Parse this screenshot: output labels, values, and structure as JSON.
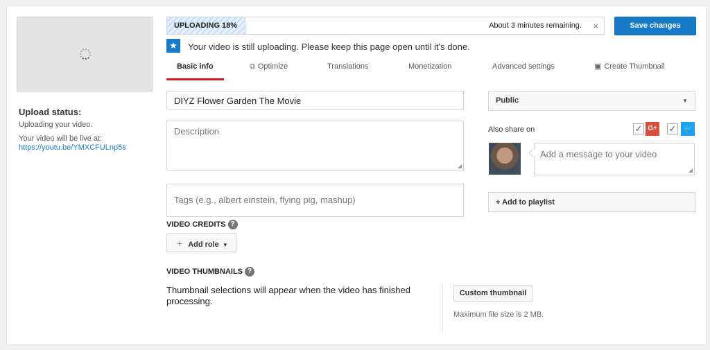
{
  "left": {
    "upload_status_title": "Upload status:",
    "upload_status_text": "Uploading your video.",
    "live_text": "Your video will be live at:",
    "live_link": "https://youtu.be/YMXCFULnp5s"
  },
  "upload": {
    "label": "UPLOADING 18%",
    "progress_percent": 18,
    "remaining": "About 3 minutes remaining.",
    "close_glyph": "×",
    "save_label": "Save changes",
    "notice": "Your video is still uploading. Please keep this page open until it's done."
  },
  "tabs": [
    {
      "label": "Basic info",
      "active": true
    },
    {
      "label": "Optimize",
      "icon": "optimize-icon"
    },
    {
      "label": "Translations"
    },
    {
      "label": "Monetization"
    },
    {
      "label": "Advanced settings"
    },
    {
      "label": "Create Thumbnail",
      "icon": "thumbnail-icon"
    }
  ],
  "form": {
    "title_value": "DIYZ Flower Garden   The Movie",
    "description_placeholder": "Description",
    "tags_placeholder": "Tags (e.g., albert einstein, flying pig, mashup)",
    "video_credits_label": "VIDEO CREDITS",
    "add_role_label": "Add role",
    "video_thumbnails_label": "VIDEO THUMBNAILS",
    "thumbnail_message": "Thumbnail selections will appear when the video has finished processing.",
    "custom_thumbnail_label": "Custom thumbnail",
    "max_size_text": "Maximum file size is 2 MB."
  },
  "side": {
    "privacy_value": "Public",
    "share_label": "Also share on",
    "gplus_label": "G+",
    "message_placeholder": "Add a message to your video",
    "add_playlist_label": "+ Add to playlist"
  },
  "colors": {
    "accent": "#167ac6",
    "tab_underline": "#cc181e",
    "gplus": "#dd4b39",
    "twitter": "#1da1f2"
  }
}
